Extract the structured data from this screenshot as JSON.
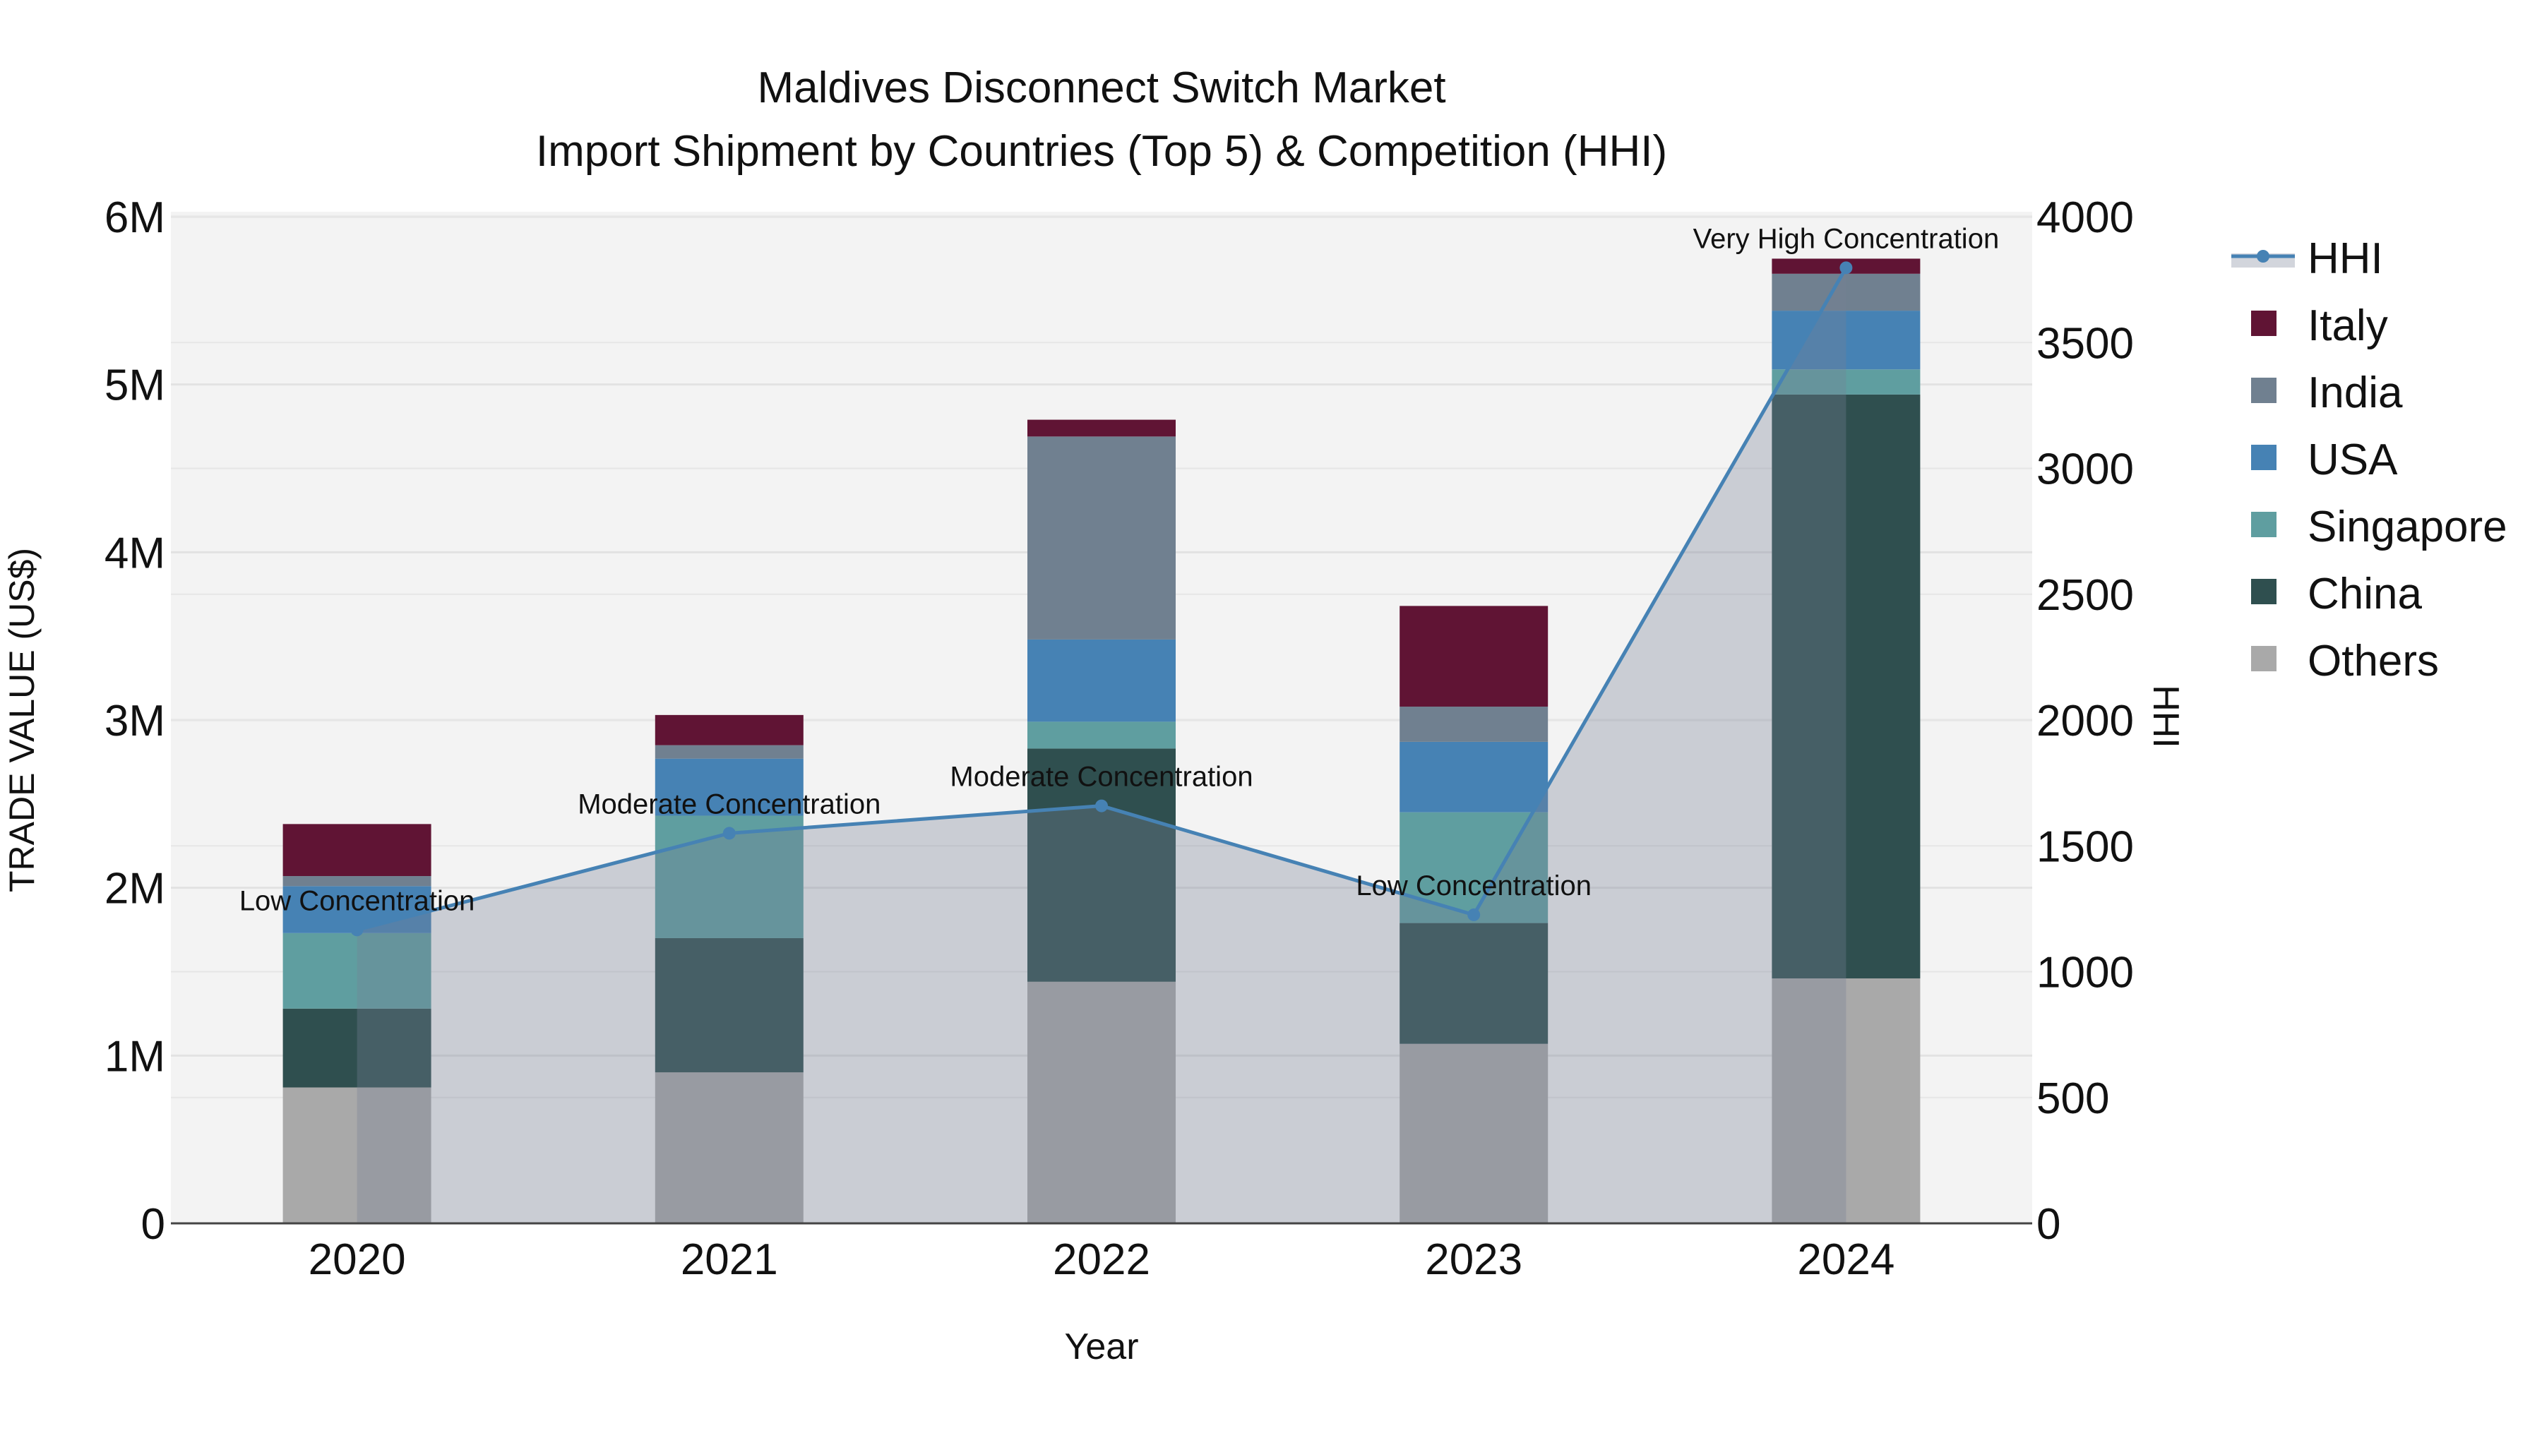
{
  "chart_data": {
    "type": "bar",
    "title": "Maldives Disconnect Switch Market",
    "subtitle": "Import Shipment by Countries (Top 5) & Competition (HHI)",
    "xlabel": "Year",
    "ylabel": "TRADE VALUE (US$)",
    "y2label": "HHI",
    "categories": [
      "2020",
      "2021",
      "2022",
      "2023",
      "2024"
    ],
    "ylim": [
      0,
      6000000
    ],
    "y_ticks": [
      {
        "v": 0,
        "label": "0"
      },
      {
        "v": 1000000,
        "label": "1M"
      },
      {
        "v": 2000000,
        "label": "2M"
      },
      {
        "v": 3000000,
        "label": "3M"
      },
      {
        "v": 4000000,
        "label": "4M"
      },
      {
        "v": 5000000,
        "label": "5M"
      },
      {
        "v": 6000000,
        "label": "6M"
      }
    ],
    "y2lim": [
      0,
      4000
    ],
    "y2_ticks": [
      "0",
      "500",
      "1000",
      "1500",
      "2000",
      "2500",
      "3000",
      "3500",
      "4000"
    ],
    "grid": true,
    "legend_position": "right",
    "series": [
      {
        "name": "Others",
        "color": "#a9a9a9",
        "values": [
          810000,
          900000,
          1440000,
          1070000,
          1460000
        ]
      },
      {
        "name": "China",
        "color": "#2f4f4f",
        "values": [
          470000,
          800000,
          1390000,
          720000,
          3480000
        ]
      },
      {
        "name": "Singapore",
        "color": "#5f9ea0",
        "values": [
          450000,
          730000,
          160000,
          660000,
          150000
        ]
      },
      {
        "name": "USA",
        "color": "#4682b4",
        "values": [
          280000,
          340000,
          490000,
          420000,
          350000
        ]
      },
      {
        "name": "India",
        "color": "#708090",
        "values": [
          60000,
          80000,
          1210000,
          210000,
          220000
        ]
      },
      {
        "name": "Italy",
        "color": "#601434",
        "values": [
          310000,
          180000,
          100000,
          600000,
          90000
        ]
      }
    ],
    "hhi": {
      "name": "HHI",
      "color": "#4682b4",
      "values": [
        1166,
        1550,
        1659,
        1226,
        3797
      ],
      "annotations": [
        "Low Concentration",
        "Moderate Concentration",
        "Moderate Concentration",
        "Low Concentration",
        "Very High Concentration"
      ]
    },
    "legend_order": [
      "HHI",
      "Italy",
      "India",
      "USA",
      "Singapore",
      "China",
      "Others"
    ]
  }
}
